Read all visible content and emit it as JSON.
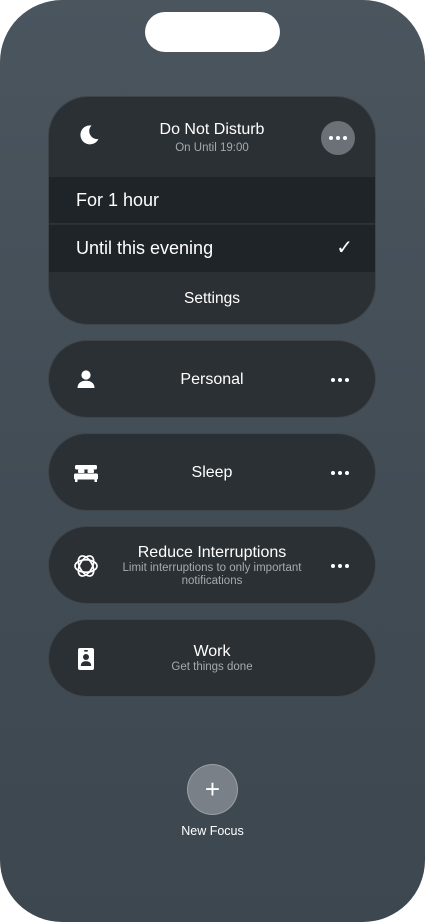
{
  "dnd": {
    "title": "Do Not Disturb",
    "subtitle": "On Until 19:00",
    "icon": "moon-icon",
    "options": [
      {
        "label": "For 1 hour",
        "selected": false
      },
      {
        "label": "Until this evening",
        "selected": true
      }
    ],
    "checkmark": "✓",
    "settings_label": "Settings"
  },
  "focus_modes": [
    {
      "title": "Personal",
      "subtitle": "",
      "icon": "person-icon",
      "has_more": true
    },
    {
      "title": "Sleep",
      "subtitle": "",
      "icon": "bed-icon",
      "has_more": true
    },
    {
      "title": "Reduce Interruptions",
      "subtitle": "Limit interruptions to only important notifications",
      "icon": "intelligence-icon",
      "has_more": true
    },
    {
      "title": "Work",
      "subtitle": "Get things done",
      "icon": "id-badge-icon",
      "has_more": false
    }
  ],
  "new_focus": {
    "label": "New Focus",
    "symbol": "+"
  },
  "colors": {
    "card": "#2b3035",
    "selected_row": "#1f2428",
    "background": "#46515a"
  }
}
